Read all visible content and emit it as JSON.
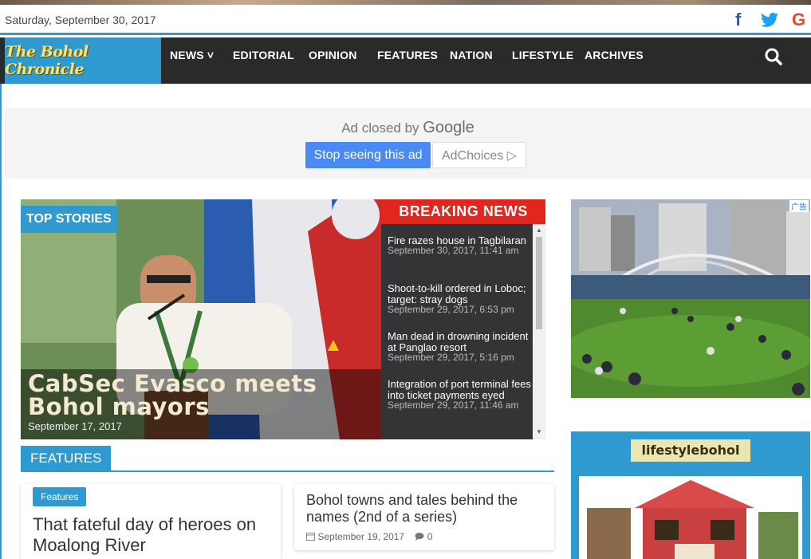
{
  "header": {
    "date": "Saturday, September 30, 2017",
    "social": [
      {
        "name": "facebook",
        "glyph": "f"
      },
      {
        "name": "twitter",
        "glyph": "t"
      },
      {
        "name": "google",
        "glyph": "G"
      }
    ]
  },
  "nav": {
    "logo": "The Bohol Chronicle",
    "items": [
      "NEWS",
      "EDITORIAL",
      "OPINION",
      "FEATURES",
      "NATION",
      "LIFESTYLE",
      "ARCHIVES"
    ],
    "news_chevron": "˅"
  },
  "ad_top": {
    "closed_prefix": "Ad closed by",
    "closed_brand": "Google",
    "stop_button": "Stop seeing this ad",
    "adchoices_button": "AdChoices ▷"
  },
  "hero": {
    "section_label": "TOP STORIES",
    "title": "CabSec Evasco meets Bohol mayors",
    "date": "September 17, 2017"
  },
  "breaking": {
    "label": "BREAKING NEWS",
    "items": [
      {
        "title": "Fire razes house in Tagbilaran",
        "date": "September 30, 2017, 11:41 am"
      },
      {
        "title": "Shoot-to-kill ordered in Loboc; target: stray dogs",
        "date": "September 29, 2017, 6:53 pm"
      },
      {
        "title": "Man dead in drowning incident at Panglao resort",
        "date": "September 29, 2017, 5:16 pm"
      },
      {
        "title": "Integration of port terminal fees into ticket payments eyed",
        "date": "September 29, 2017, 11:46 am"
      }
    ]
  },
  "features": {
    "label": "FEATURES",
    "cards": [
      {
        "badge": "Features",
        "title": "That fateful day of heroes on Moalong River"
      },
      {
        "title": "Bohol towns and tales behind the names (2nd of a series)",
        "date": "September 19, 2017",
        "comments": "0"
      }
    ]
  },
  "sidebar": {
    "ad_tag": "广告",
    "lifestyle_logo": "lifestylebohol"
  },
  "colors": {
    "accent": "#2e9ad0",
    "nav_bg": "#2a2a2a",
    "breaking_red": "#e0261e",
    "logo_text": "#fde36a"
  }
}
